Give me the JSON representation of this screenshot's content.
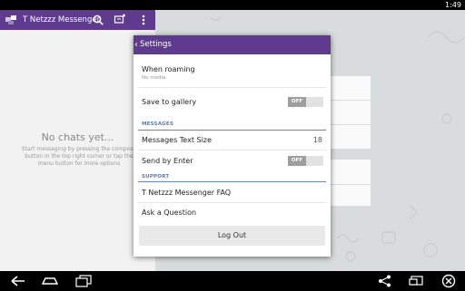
{
  "status_bar": {
    "clock": "1:49"
  },
  "app": {
    "title": "T Netzzz Messenger",
    "icons": [
      "app-logo-icon",
      "search-icon",
      "compose-icon",
      "overflow-menu-icon"
    ],
    "empty_title": "No chats yet...",
    "empty_text": "Start messaging by pressing the compose button in the top right corner or tap the menu button for more options"
  },
  "settings": {
    "header_title": "Settings",
    "back_icon": "chevron-left-icon",
    "roaming_label": "When roaming",
    "roaming_value": "No media",
    "save_gallery_label": "Save to gallery",
    "save_gallery_toggle": "OFF",
    "messages_section": "MESSAGES",
    "text_size_label": "Messages Text Size",
    "text_size_value": "18",
    "send_enter_label": "Send by Enter",
    "send_enter_toggle": "OFF",
    "support_section": "SUPPORT",
    "faq_label": "T Netzzz Messenger FAQ",
    "ask_label": "Ask a Question",
    "logout_label": "Log Out"
  },
  "nav_bar": {
    "icons": [
      "back-icon",
      "home-icon",
      "recent-apps-icon",
      "share-icon",
      "window-icon",
      "close-icon"
    ]
  },
  "colors": {
    "accent": "#5e3b8f",
    "section_text": "#5e79a8",
    "panel_bg": "#f2f2f2",
    "wallpaper": "#d9dcdc"
  }
}
